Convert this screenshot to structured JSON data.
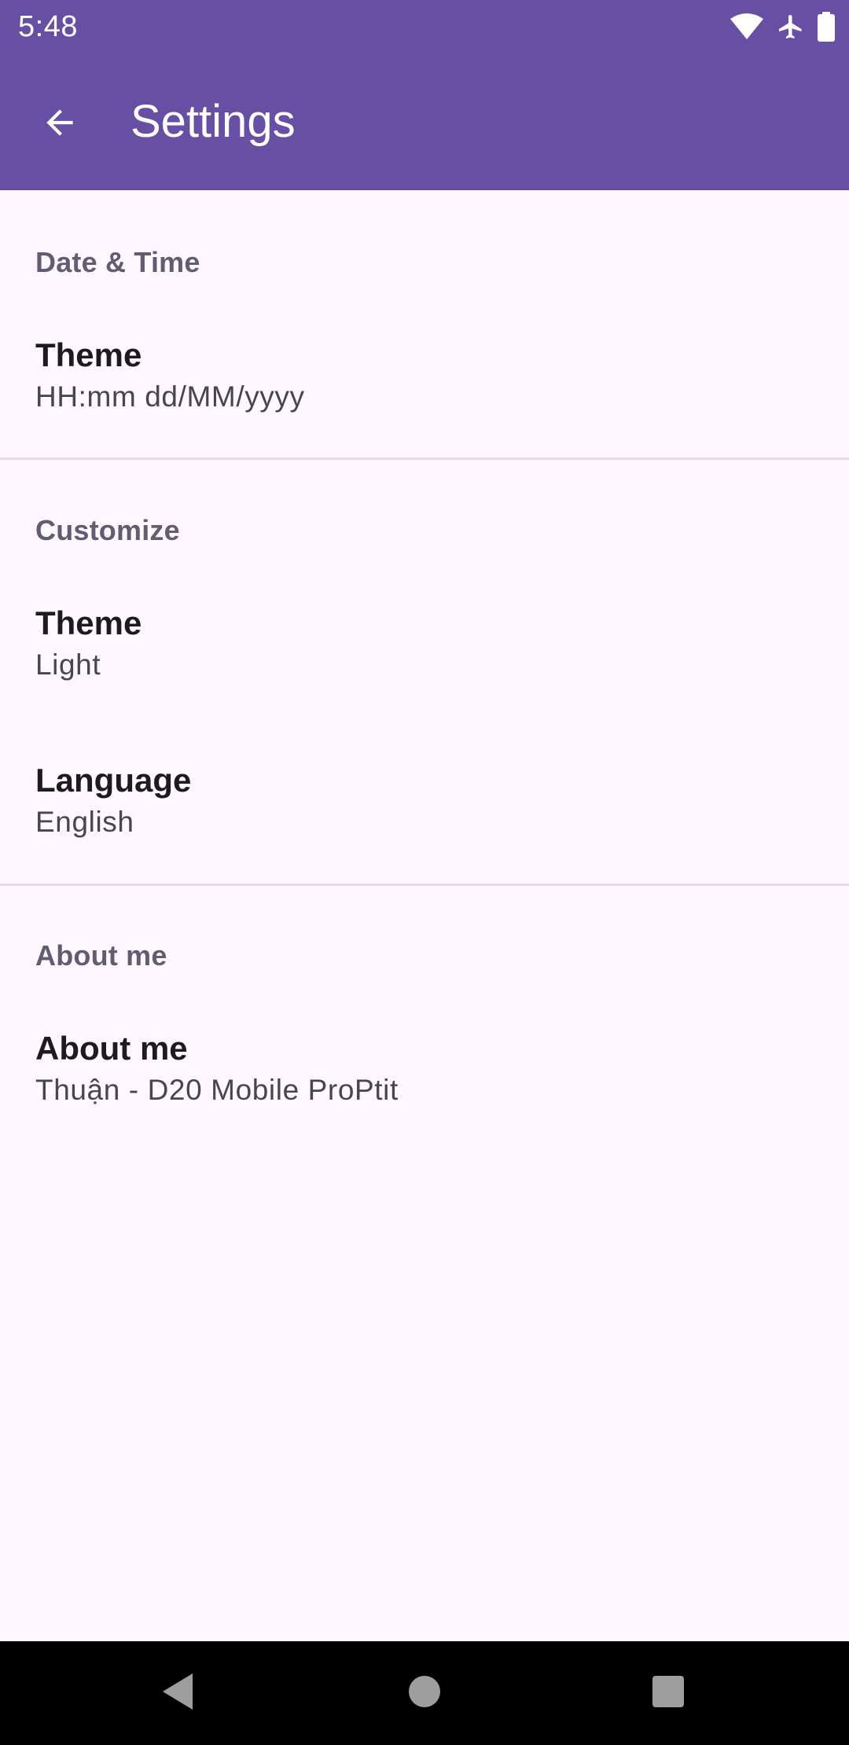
{
  "status_bar": {
    "time": "5:48",
    "icons": [
      "wifi-icon",
      "airplane-mode-icon",
      "battery-icon"
    ]
  },
  "app_bar": {
    "title": "Settings",
    "back_icon": "arrow-back-icon"
  },
  "sections": [
    {
      "title": "Date & Time",
      "items": [
        {
          "title": "Theme",
          "summary": "HH:mm dd/MM/yyyy"
        }
      ]
    },
    {
      "title": "Customize",
      "items": [
        {
          "title": "Theme",
          "summary": "Light"
        },
        {
          "title": "Language",
          "summary": "English"
        }
      ]
    },
    {
      "title": "About me",
      "items": [
        {
          "title": "About me",
          "summary": "Thuận - D20 Mobile ProPtit"
        }
      ]
    }
  ],
  "nav_bar": {
    "buttons": [
      "back-triangle-icon",
      "home-circle-icon",
      "recents-square-icon"
    ]
  },
  "colors": {
    "primary": "#6750A4",
    "background": "#FEF7FF",
    "category_text": "#625B71",
    "title_text": "#1D1B20",
    "summary_text": "#49454F",
    "divider": "#E3DEE6"
  }
}
